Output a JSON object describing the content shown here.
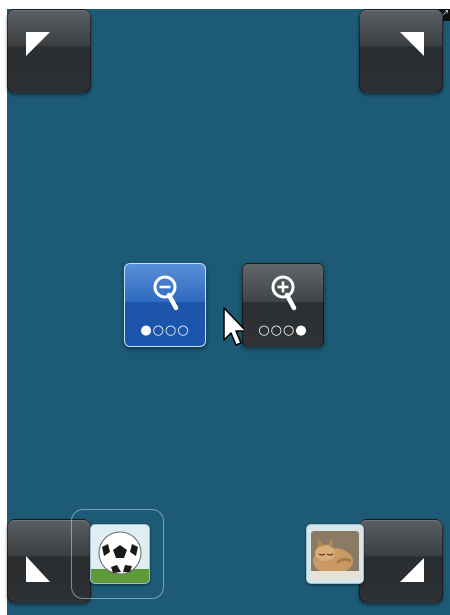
{
  "window": {
    "resize_grip_icon": "resize-diagonal-icon",
    "resize_grip_glyph": "⤢"
  },
  "corners": {
    "top_left": {
      "icon": "arrow-top-left-icon"
    },
    "top_right": {
      "icon": "arrow-top-right-icon"
    },
    "bottom_left": {
      "icon": "arrow-bottom-left-icon"
    },
    "bottom_right": {
      "icon": "arrow-bottom-right-icon"
    }
  },
  "zoom": {
    "zoom_out": {
      "icon": "zoom-out-icon",
      "dots": "●○○○",
      "active": true
    },
    "zoom_in": {
      "icon": "zoom-in-icon",
      "dots": "○○○●",
      "active": false
    }
  },
  "thumbnails": [
    {
      "icon": "soccer-ball-image"
    },
    {
      "icon": "sleeping-kitten-image"
    }
  ],
  "colors": {
    "background": "#1c5a76",
    "active_button": "#2563b8",
    "corner_button": "#3b3f42"
  }
}
